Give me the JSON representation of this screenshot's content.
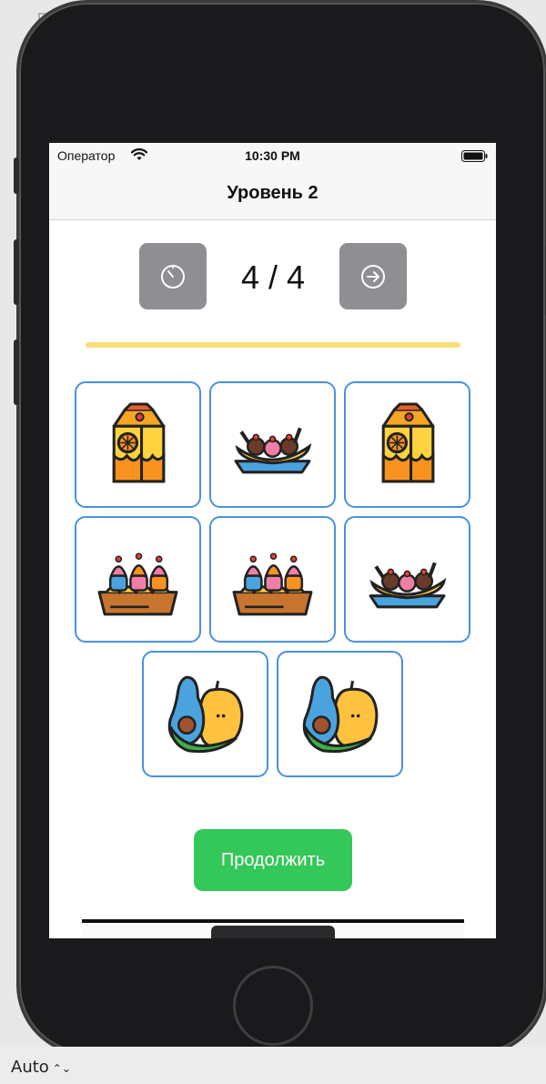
{
  "background": {
    "top_text": "Fi",
    "bottom_label": "Auto"
  },
  "status_bar": {
    "carrier": "Оператор",
    "time": "10:30 PM"
  },
  "nav": {
    "title": "Уровень 2"
  },
  "game": {
    "counter": "4 / 4",
    "progress": 1.0,
    "timer_icon": "timer-icon",
    "next_icon": "arrow-right-circle-icon",
    "cards": [
      {
        "item": "juice-carton"
      },
      {
        "item": "banana-split"
      },
      {
        "item": "juice-carton"
      },
      {
        "item": "cupcake-tray"
      },
      {
        "item": "cupcake-tray"
      },
      {
        "item": "banana-split"
      },
      {
        "item": "avocado-fruits"
      },
      {
        "item": "avocado-fruits"
      }
    ],
    "continue_label": "Продолжить"
  },
  "colors": {
    "card_border": "#4a90e2",
    "continue_button": "#34c759",
    "control_button": "#8e8e93",
    "progress": "#f7df7a"
  }
}
